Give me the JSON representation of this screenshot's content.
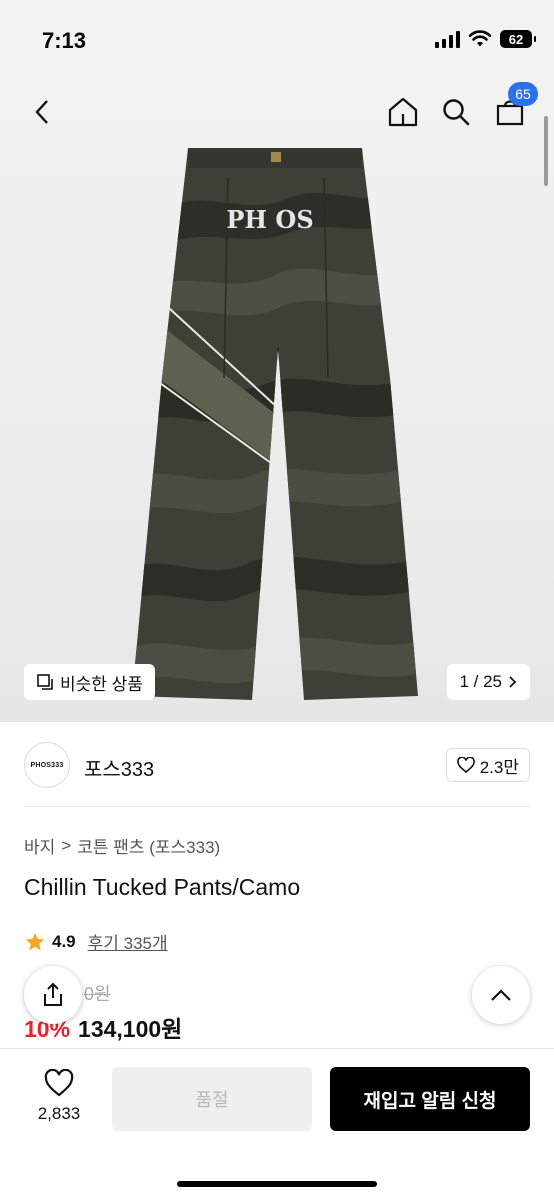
{
  "status_bar": {
    "time": "7:13",
    "battery": "62"
  },
  "nav": {
    "cart_count": "65"
  },
  "gallery": {
    "similar_label": "비슷한 상품",
    "page_indicator": "1 / 25",
    "logo_text": "PH OS"
  },
  "brand": {
    "logo_text": "PHOS333",
    "name": "포스333",
    "likes": "2.3만"
  },
  "breadcrumb": {
    "category": "바지",
    "separator": ">",
    "subcategory": "코튼 팬츠 (포스333)"
  },
  "product": {
    "title": "Chillin Tucked Pants/Camo",
    "rating": "4.9",
    "reviews": "후기 335개",
    "original_price": "0원",
    "discount": "10%",
    "sale_price": "134,100원"
  },
  "bottom_bar": {
    "wish_count": "2,833",
    "soldout_label": "품절",
    "restock_label": "재입고 알림 신청"
  },
  "colors": {
    "accent_blue": "#2a72e8",
    "discount_red": "#e8232b",
    "star": "#f5a623"
  }
}
